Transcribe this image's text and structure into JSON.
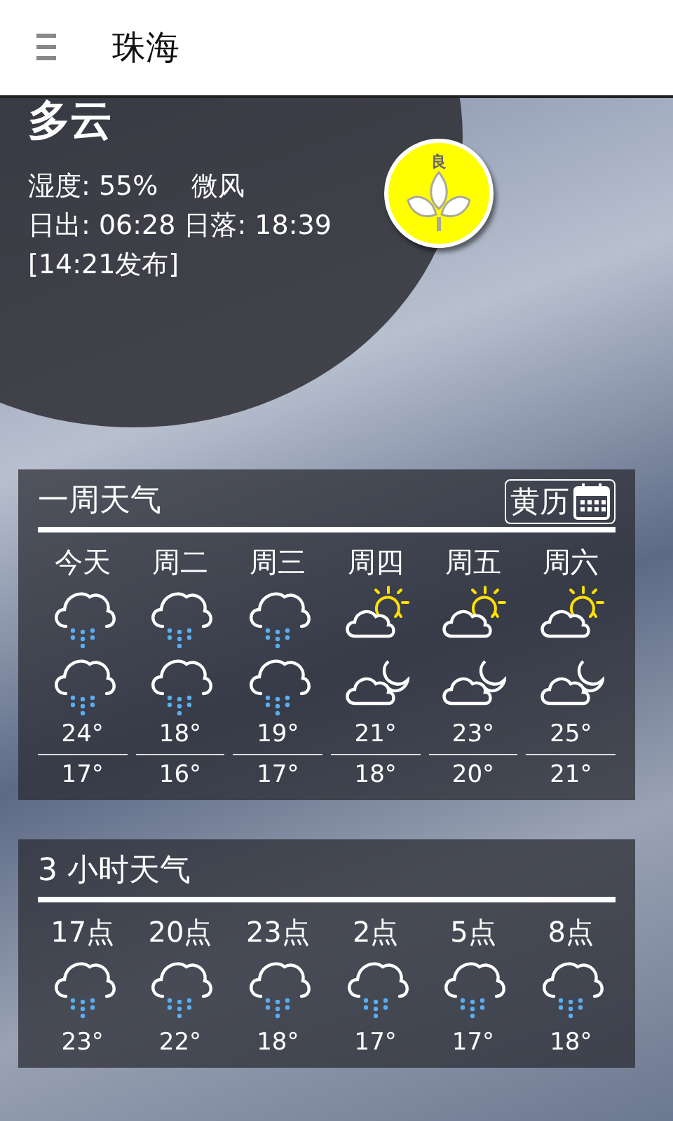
{
  "header": {
    "title": "珠海"
  },
  "current": {
    "condition": "多云",
    "humidity": "湿度: 55%",
    "wind": "微风",
    "sun": "日出: 06:28 日落: 18:39",
    "published": "[14:21发布]",
    "aqi_label": "良"
  },
  "weekly": {
    "title": "一周天气",
    "almanac_button": "黄历",
    "days": [
      {
        "label": "今天",
        "day": {
          "kind": "rain"
        },
        "night": {
          "kind": "rain"
        },
        "high": "24°",
        "low": "17°"
      },
      {
        "label": "周二",
        "day": {
          "kind": "rain"
        },
        "night": {
          "kind": "rain"
        },
        "high": "18°",
        "low": "16°"
      },
      {
        "label": "周三",
        "day": {
          "kind": "rain"
        },
        "night": {
          "kind": "rain"
        },
        "high": "19°",
        "low": "17°"
      },
      {
        "label": "周四",
        "day": {
          "kind": "sunny"
        },
        "night": {
          "kind": "night"
        },
        "high": "21°",
        "low": "18°"
      },
      {
        "label": "周五",
        "day": {
          "kind": "sunny"
        },
        "night": {
          "kind": "night"
        },
        "high": "23°",
        "low": "20°"
      },
      {
        "label": "周六",
        "day": {
          "kind": "sunny"
        },
        "night": {
          "kind": "night"
        },
        "high": "25°",
        "low": "21°"
      }
    ]
  },
  "hourly": {
    "title": "3 小时天气",
    "hours": [
      {
        "label": "17点",
        "kind": "rain",
        "temp": "23°"
      },
      {
        "label": "20点",
        "kind": "rain",
        "temp": "22°"
      },
      {
        "label": "23点",
        "kind": "rain",
        "temp": "18°"
      },
      {
        "label": "2点",
        "kind": "rain",
        "temp": "17°"
      },
      {
        "label": "5点",
        "kind": "rain",
        "temp": "17°"
      },
      {
        "label": "8点",
        "kind": "rain",
        "temp": "18°"
      }
    ]
  }
}
